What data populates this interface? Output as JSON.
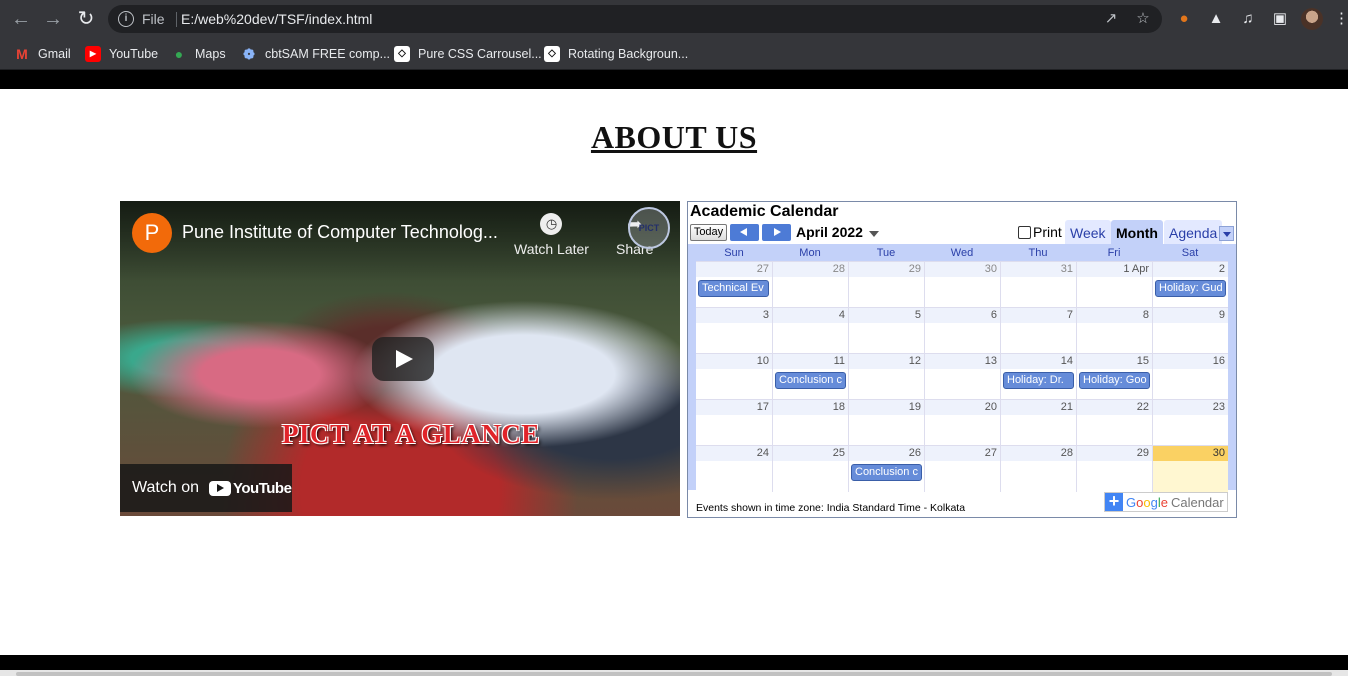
{
  "browser": {
    "omnibox": {
      "prefix": "File",
      "url": "E:/web%20dev/TSF/index.html"
    },
    "bookmarks": [
      {
        "label": "Gmail",
        "icon": "gmail-icon"
      },
      {
        "label": "YouTube",
        "icon": "youtube-icon"
      },
      {
        "label": "Maps",
        "icon": "maps-icon"
      },
      {
        "label": "cbtSAM FREE comp...",
        "icon": "cbtsam-icon"
      },
      {
        "label": "Pure CSS Carrousel...",
        "icon": "codepen-icon"
      },
      {
        "label": "Rotating Backgroun...",
        "icon": "codepen-icon"
      }
    ]
  },
  "page": {
    "title": "ABOUT US"
  },
  "video": {
    "channel_initial": "P",
    "title": "Pune Institute of Computer Technolog...",
    "watch_later": "Watch Later",
    "share": "Share",
    "logo_text": "PICT",
    "overlay_text": "PICT AT A GLANCE",
    "watch_on": "Watch on",
    "youtube": "YouTube"
  },
  "calendar": {
    "title": "Academic Calendar",
    "today": "Today",
    "month": "April 2022",
    "print": "Print",
    "tabs": [
      "Week",
      "Month",
      "Agenda"
    ],
    "weekdays": [
      "Sun",
      "Mon",
      "Tue",
      "Wed",
      "Thu",
      "Fri",
      "Sat"
    ],
    "weeks": [
      [
        {
          "d": "27",
          "other": true,
          "event": "Technical Ev"
        },
        {
          "d": "28",
          "other": true
        },
        {
          "d": "29",
          "other": true
        },
        {
          "d": "30",
          "other": true
        },
        {
          "d": "31",
          "other": true
        },
        {
          "d": "1 Apr"
        },
        {
          "d": "2",
          "event": "Holiday: Gud"
        }
      ],
      [
        {
          "d": "3"
        },
        {
          "d": "4"
        },
        {
          "d": "5"
        },
        {
          "d": "6"
        },
        {
          "d": "7"
        },
        {
          "d": "8"
        },
        {
          "d": "9"
        }
      ],
      [
        {
          "d": "10"
        },
        {
          "d": "11",
          "event": "Conclusion c"
        },
        {
          "d": "12"
        },
        {
          "d": "13"
        },
        {
          "d": "14",
          "event": "Holiday: Dr."
        },
        {
          "d": "15",
          "event": "Holiday: Goo"
        },
        {
          "d": "16"
        }
      ],
      [
        {
          "d": "17"
        },
        {
          "d": "18"
        },
        {
          "d": "19"
        },
        {
          "d": "20"
        },
        {
          "d": "21"
        },
        {
          "d": "22"
        },
        {
          "d": "23"
        }
      ],
      [
        {
          "d": "24"
        },
        {
          "d": "25"
        },
        {
          "d": "26",
          "event": "Conclusion c"
        },
        {
          "d": "27"
        },
        {
          "d": "28"
        },
        {
          "d": "29"
        },
        {
          "d": "30",
          "today": true
        }
      ]
    ],
    "footer": "Events shown in time zone: India Standard Time - Kolkata",
    "gcal_label": [
      "G",
      "o",
      "o",
      "g",
      "l",
      "e"
    ],
    "gcal_suffix": "Calendar"
  },
  "colors": {
    "event": "#668cd9",
    "today": "#fad163",
    "accent": "#4d7bd6"
  }
}
